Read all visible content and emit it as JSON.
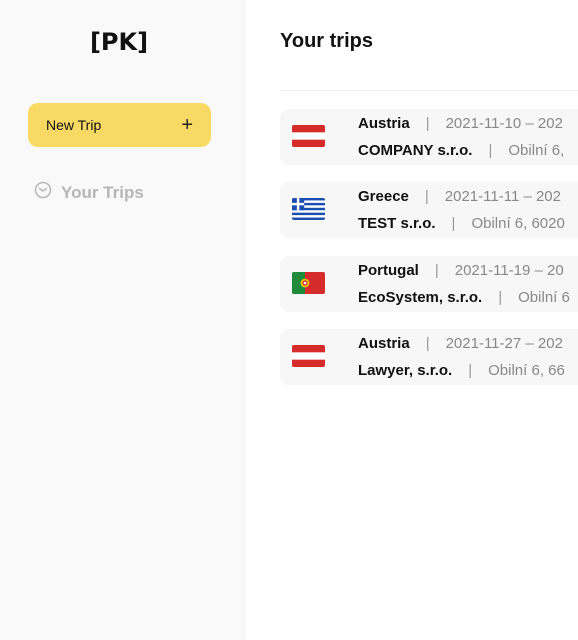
{
  "sidebar": {
    "logo": "[PK]",
    "new_trip_label": "New Trip",
    "new_trip_icon": "plus-icon",
    "nav_items": [
      {
        "label": "Your Trips",
        "icon": "clock-icon"
      }
    ]
  },
  "main": {
    "title": "Your trips",
    "trips": [
      {
        "country": "Austria",
        "flag": "austria-flag-icon",
        "dates": "2021-11-10 – 202",
        "company": "COMPANY s.r.o.",
        "address": "Obilní 6,"
      },
      {
        "country": "Greece",
        "flag": "greece-flag-icon",
        "dates": "2021-11-11 – 202",
        "company": "TEST s.r.o.",
        "address": "Obilní 6, 6020"
      },
      {
        "country": "Portugal",
        "flag": "portugal-flag-icon",
        "dates": "2021-11-19 – 20",
        "company": "EcoSystem, s.r.o.",
        "address": "Obilní 6"
      },
      {
        "country": "Austria",
        "flag": "austria-flag-icon",
        "dates": "2021-11-27 – 202",
        "company": "Lawyer, s.r.o.",
        "address": "Obilní 6, 66"
      }
    ]
  },
  "colors": {
    "accent": "#f8d964",
    "sidebar_bg": "#f9f9f9",
    "card_bg": "#f7f7f7"
  }
}
